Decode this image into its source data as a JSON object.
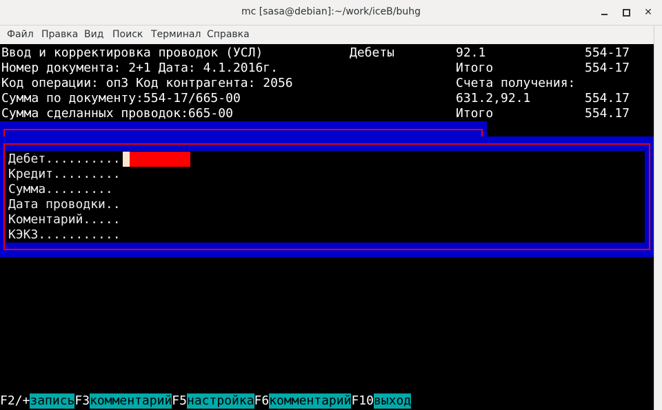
{
  "window": {
    "title": "mc [sasa@debian]:~/work/iceB/buhg"
  },
  "menu": [
    "Файл",
    "Правка",
    "Вид",
    "Поиск",
    "Терминал",
    "Справка"
  ],
  "header": {
    "r1_left": "Ввод и корректировка проводок (УСЛ)",
    "r1_mid": "Дебеты",
    "r1_acc": "92.1",
    "r1_sum": "554-17",
    "r2_left": "Номер документа: 2+1 Дата: 4.1.2016г.",
    "r2_acc": "Итого",
    "r2_sum": "554-17",
    "r3_left": "Код операции: оп3 Код контрагента: 2056",
    "r3_acc": "Счета получения:",
    "r4_left": "Сумма по документу:554-17/665-00",
    "r4_acc": "631.2,92.1",
    "r4_sum": "554.17",
    "r5_left": "Сумма сделанных проводок:665-00",
    "r5_acc": "Итого",
    "r5_sum": "554.17"
  },
  "form": {
    "fields": [
      "Дебет..........",
      "Кредит.........",
      "Сумма.........",
      "Дата проводки..",
      "Коментарий.....",
      "КЭКЗ..........."
    ],
    "debit_value": ""
  },
  "fkeys": [
    {
      "key": "F2/+",
      "action": "запись"
    },
    {
      "key": "F3",
      "action": "комментарий"
    },
    {
      "key": "F5",
      "action": "настройка"
    },
    {
      "key": "F6",
      "action": "комментарий"
    },
    {
      "key": "F10",
      "action": "выход"
    }
  ],
  "colors": {
    "panel_blue": "#0000cc",
    "frame_red": "#ee0000",
    "input_red": "#ff0000",
    "fkey_cyan": "#00aaaa"
  }
}
